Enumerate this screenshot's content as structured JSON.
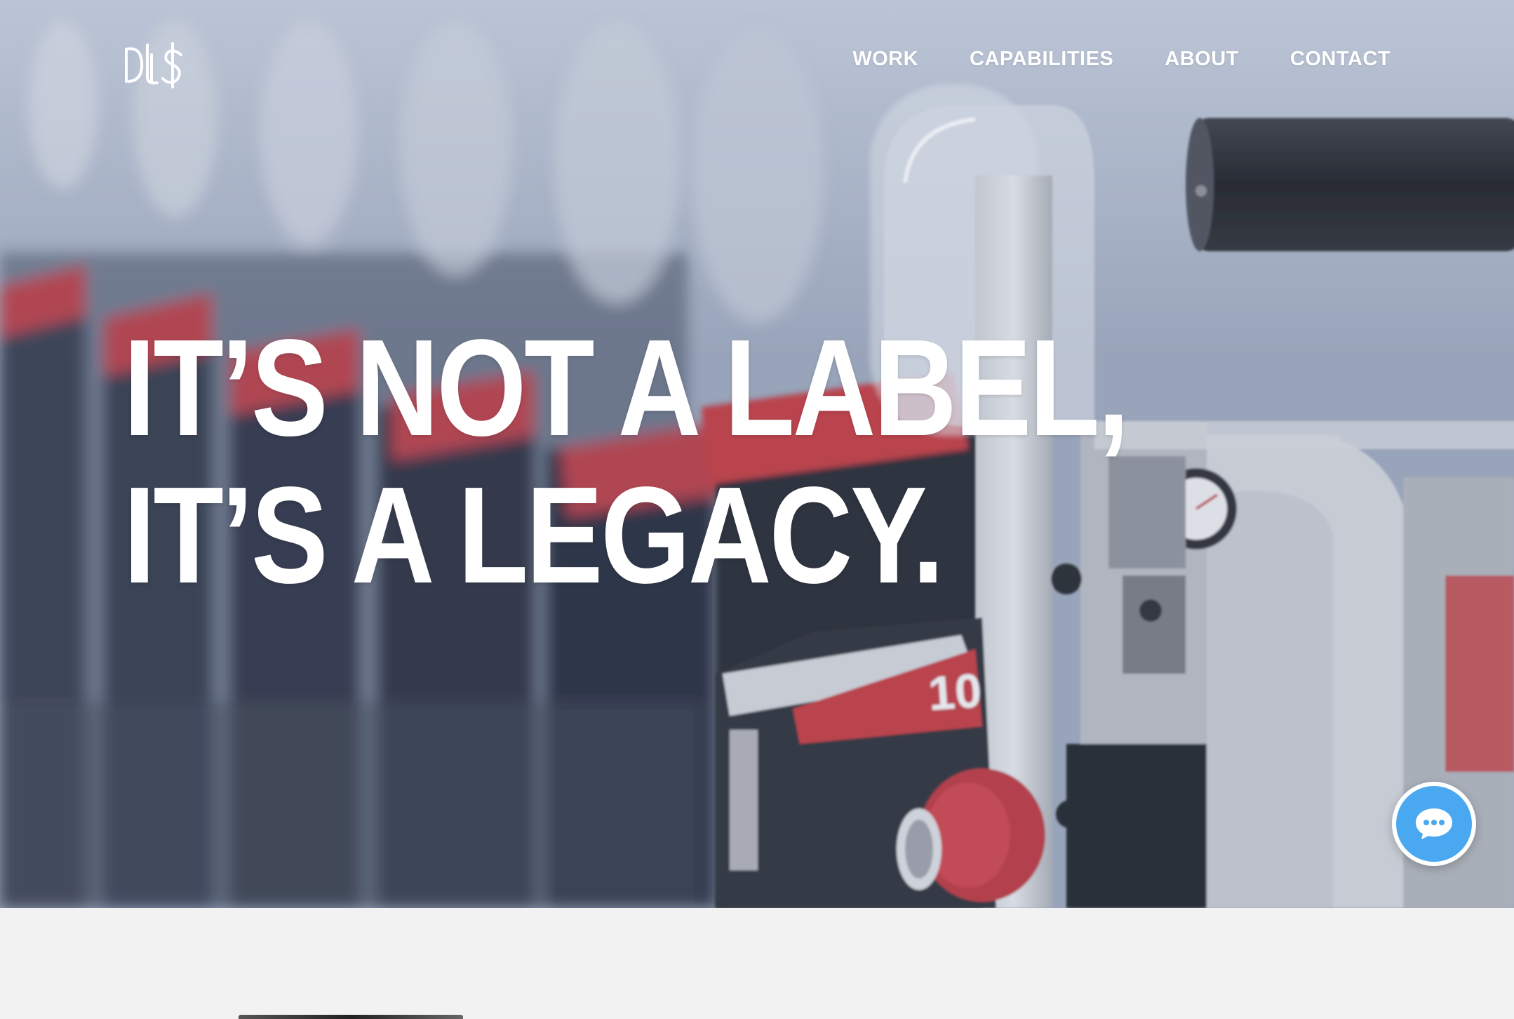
{
  "site": {
    "logo_text": "DLS"
  },
  "nav": {
    "items": [
      {
        "label": "WORK"
      },
      {
        "label": "CAPABILITIES"
      },
      {
        "label": "ABOUT"
      },
      {
        "label": "CONTACT"
      }
    ]
  },
  "hero": {
    "headline_line1": "IT’S NOT A LABEL,",
    "headline_line2": "IT’S A LEGACY.",
    "machine_number": "10"
  },
  "chat": {
    "icon": "chat-bubble-icon",
    "color": "#4aa8f0"
  },
  "colors": {
    "accent_red": "#c0383c",
    "text": "#ffffff",
    "page_bg": "#f2f2f2"
  }
}
